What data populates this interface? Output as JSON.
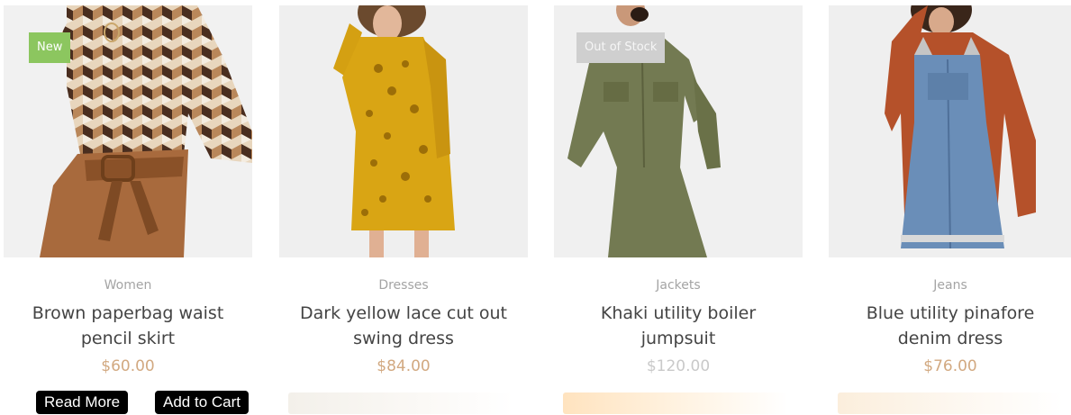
{
  "products": [
    {
      "badge": "New",
      "category": "Women",
      "title": "Brown paperbag waist pencil skirt",
      "price": "$60.00",
      "buttons": {
        "read_more": "Read More",
        "add_to_cart": "Add to Cart"
      }
    },
    {
      "category": "Dresses",
      "title": "Dark yellow lace cut out swing dress",
      "price": "$84.00"
    },
    {
      "badge": "Out of Stock",
      "category": "Jackets",
      "title": "Khaki utility boiler jumpsuit",
      "price": "$120.00"
    },
    {
      "category": "Jeans",
      "title": "Blue utility pinafore denim dress",
      "price": "$76.00"
    }
  ],
  "colors": {
    "badge_new": "#8cc65f",
    "badge_out_of_stock": "#cfcfcf",
    "price": "#d2a981",
    "title": "#444444",
    "category": "#a4a4a4",
    "button_bg": "#000000"
  }
}
